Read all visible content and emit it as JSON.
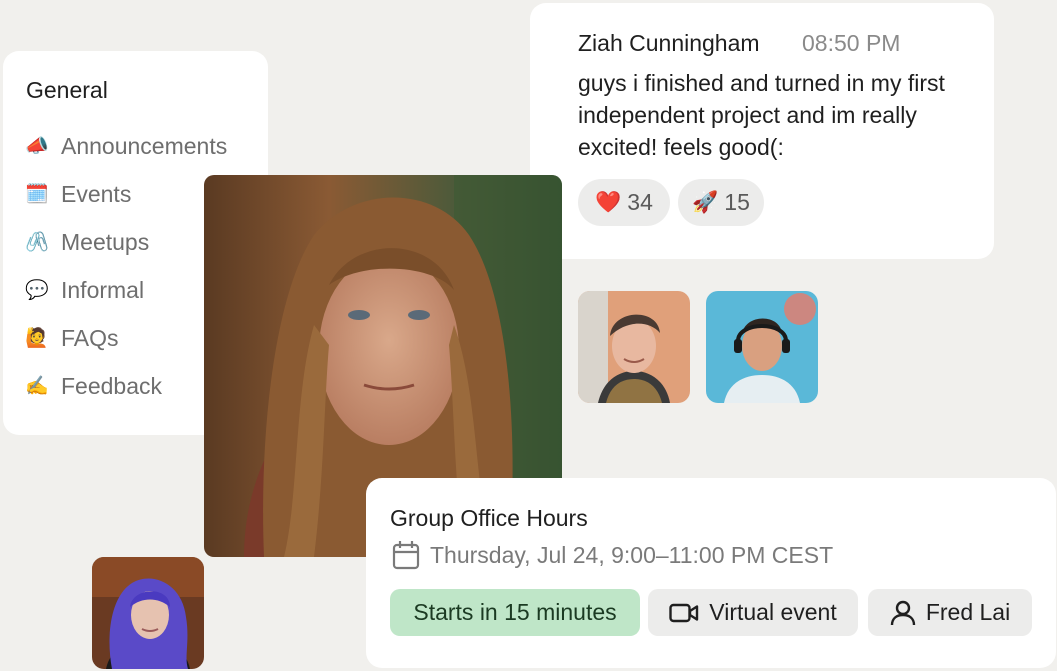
{
  "sidebar": {
    "heading": "General",
    "items": [
      {
        "emoji": "📣",
        "label": "Announcements"
      },
      {
        "emoji": "🗓️",
        "label": "Events"
      },
      {
        "emoji": "🖇️",
        "label": "Meetups"
      },
      {
        "emoji": "💬",
        "label": "Informal"
      },
      {
        "emoji": "🙋",
        "label": "FAQs"
      },
      {
        "emoji": "✍️",
        "label": "Feedback"
      }
    ]
  },
  "message": {
    "author": "Ziah Cunningham",
    "time": "08:50 PM",
    "text": "guys i finished and turned in my first independent project and im really excited! feels good(:",
    "reactions": [
      {
        "emoji": "❤️",
        "count": "34"
      },
      {
        "emoji": "🚀",
        "count": "15"
      }
    ]
  },
  "event": {
    "title": "Group Office Hours",
    "date": "Thursday, Jul 24, 9:00–11:00 PM CEST",
    "starts": "Starts in 15 minutes",
    "type": "Virtual event",
    "host": "Fred Lai"
  },
  "colors": {
    "background": "#f1f0ed",
    "card": "#ffffff",
    "starts_pill": "#bfe6c8",
    "neutral_pill": "#ececeb"
  }
}
